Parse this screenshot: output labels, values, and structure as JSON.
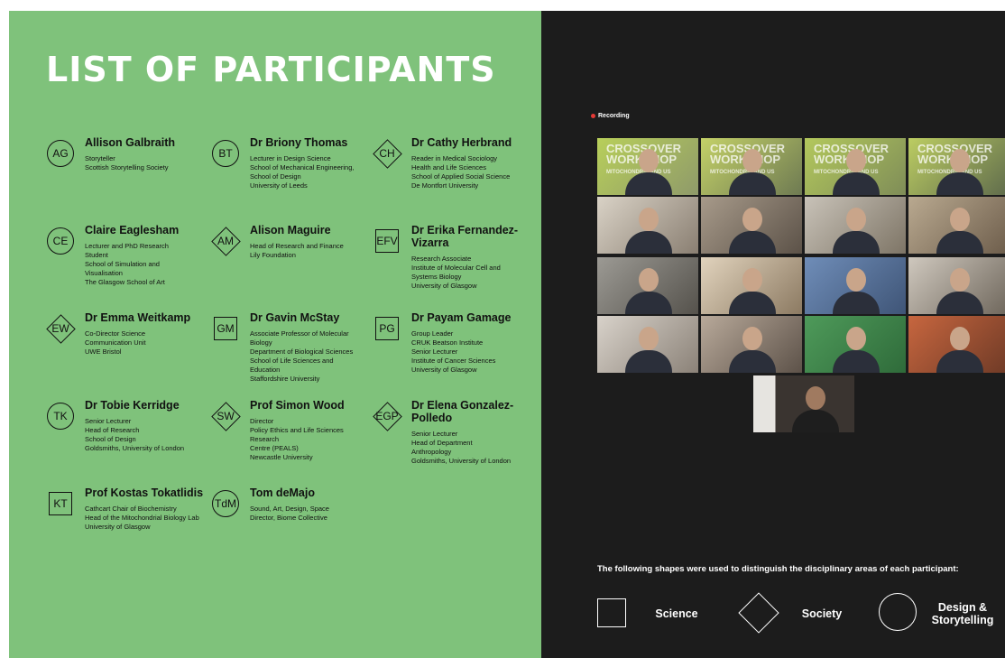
{
  "title": "LIST OF PARTICIPANTS",
  "participants": [
    {
      "initials": "AG",
      "shape": "circle",
      "name": "Allison Galbraith",
      "details": [
        "Storyteller",
        "Scottish Storytelling Society"
      ]
    },
    {
      "initials": "BT",
      "shape": "circle",
      "name": "Dr Briony Thomas",
      "details": [
        "Lecturer in Design Science",
        "School of Mechanical Engineering,",
        "School of Design",
        "University of Leeds"
      ]
    },
    {
      "initials": "CH",
      "shape": "diamond",
      "name": "Dr Cathy Herbrand",
      "details": [
        "Reader in Medical Sociology",
        "Health and Life Sciences",
        "School of Applied Social Science",
        "De Montfort University"
      ]
    },
    {
      "initials": "CE",
      "shape": "circle",
      "name": "Claire Eaglesham",
      "details": [
        "Lecturer and PhD Research",
        "Student",
        "School of Simulation and",
        "Visualisation",
        "The Glasgow School of Art"
      ]
    },
    {
      "initials": "AM",
      "shape": "diamond",
      "name": "Alison Maguire",
      "details": [
        "Head of Research and Finance",
        "Lily Foundation"
      ]
    },
    {
      "initials": "EFV",
      "shape": "square",
      "name": "Dr Erika Fernandez-Vizarra",
      "details": [
        "Research Associate",
        "Institute of Molecular Cell and",
        "Systems Biology",
        "University of Glasgow"
      ]
    },
    {
      "initials": "EW",
      "shape": "diamond",
      "name": "Dr Emma Weitkamp",
      "details": [
        "Co-Director Science",
        "Communication Unit",
        "UWE Bristol"
      ]
    },
    {
      "initials": "GM",
      "shape": "square",
      "name": "Dr Gavin McStay",
      "details": [
        "Associate Professor of Molecular",
        "Biology",
        "Department of Biological Sciences",
        "School of Life Sciences and",
        "Education",
        "Staffordshire University"
      ]
    },
    {
      "initials": "PG",
      "shape": "square",
      "name": "Dr Payam Gamage",
      "details": [
        "Group Leader",
        "CRUK Beatson Institute",
        "Senior Lecturer",
        "Institute of Cancer Sciences",
        "University of Glasgow"
      ]
    },
    {
      "initials": "TK",
      "shape": "circle",
      "name": "Dr Tobie Kerridge",
      "details": [
        "Senior Lecturer",
        "Head of Research",
        "School of Design",
        "Goldsmiths, University of London"
      ]
    },
    {
      "initials": "SW",
      "shape": "diamond",
      "name": "Prof Simon Wood",
      "details": [
        "Director",
        "Policy Ethics and Life Sciences",
        "Research",
        "Centre (PEALS)",
        "Newcastle University"
      ]
    },
    {
      "initials": "EGP",
      "shape": "diamond",
      "name": "Dr Elena Gonzalez-Polledo",
      "details": [
        "Senior Lecturer",
        "Head of Department",
        "Anthropology",
        "Goldsmiths, University of London"
      ]
    },
    {
      "initials": "KT",
      "shape": "square",
      "name": "Prof Kostas Tokatlidis",
      "details": [
        "Cathcart Chair of Biochemistry",
        "Head of the Mitochondrial Biology Lab",
        "University of Glasgow"
      ]
    },
    {
      "initials": "TdM",
      "shape": "circle",
      "name": "Tom deMajo",
      "details": [
        "Sound, Art, Design, Space",
        "Director, Biome Collective"
      ]
    }
  ],
  "video": {
    "recording_label": "Recording",
    "banner_line1": "CROSSOVER",
    "banner_line2": "WORKSHOP",
    "banner_sub": "MITOCHONDRIA AND US"
  },
  "legend": {
    "text": "The following shapes were used to distinguish the disciplinary areas of each participant:",
    "items": [
      {
        "shape": "square",
        "label": "Science"
      },
      {
        "shape": "diamond",
        "label": "Society"
      },
      {
        "shape": "circle",
        "label": "Design & Storytelling"
      }
    ]
  },
  "colors": {
    "panel_green": "#7fc27b",
    "dark_bg": "#1c1c1c",
    "recording_dot": "#e53935"
  }
}
